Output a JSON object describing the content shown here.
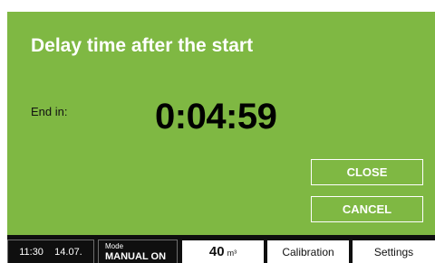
{
  "dialog": {
    "title": "Delay time after the start",
    "end_label": "End in:",
    "countdown": "0:04:59",
    "close_label": "CLOSE",
    "cancel_label": "CANCEL"
  },
  "statusbar": {
    "time": "11:30",
    "date": "14.07.",
    "mode_label": "Mode",
    "mode_value": "MANUAL ON",
    "volume_value": "40",
    "volume_unit": "m³",
    "calibration_label": "Calibration",
    "settings_label": "Settings"
  },
  "colors": {
    "panel_green": "#7fb843",
    "statusbar_black": "#0f0f0f",
    "text_white": "#ffffff"
  }
}
